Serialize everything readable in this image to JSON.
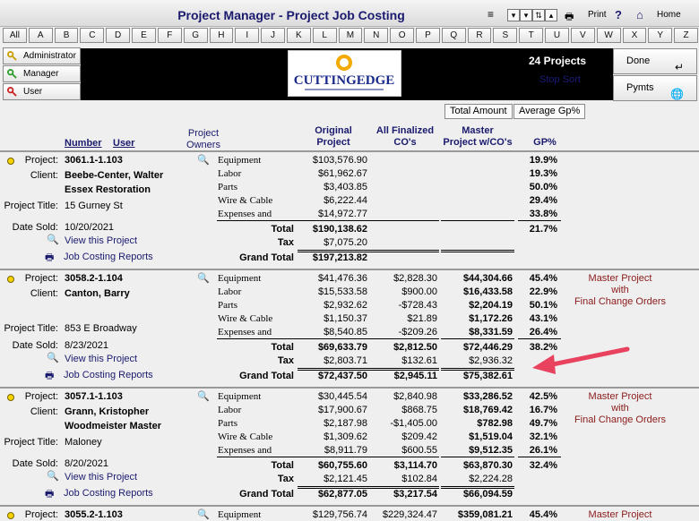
{
  "header": {
    "title": "Project Manager - Project Job Costing",
    "print_label": "Print",
    "help_label": "?",
    "home_label": "Home"
  },
  "alphabet": [
    "All",
    "A",
    "B",
    "C",
    "D",
    "E",
    "F",
    "G",
    "H",
    "I",
    "J",
    "K",
    "L",
    "M",
    "N",
    "O",
    "P",
    "Q",
    "R",
    "S",
    "T",
    "U",
    "V",
    "W",
    "X",
    "Y",
    "Z"
  ],
  "roles": [
    "Administrator",
    "Manager",
    "User"
  ],
  "logo_text": "CUTTINGEDGE",
  "project_count": "24 Projects",
  "stop_sort": "Stop Sort",
  "right_buttons": {
    "done": "Done",
    "pymts": "Pymts"
  },
  "toggles": {
    "total_amount": "Total Amount",
    "average_gp": "Average Gp%"
  },
  "columns": {
    "number": "Number",
    "user": "User",
    "project_owners_1": "Project",
    "project_owners_2": "Owners",
    "original_1": "Original",
    "original_2": "Project",
    "finalized_1": "All Finalized",
    "finalized_2": "CO's",
    "master_1": "Master",
    "master_2": "Project w/CO's",
    "gp": "GP%"
  },
  "labels": {
    "project": "Project:",
    "client": "Client:",
    "project_title": "Project Title:",
    "date_sold": "Date Sold:",
    "view_project": "View this Project",
    "job_costing": "Job Costing Reports",
    "total": "Total",
    "tax": "Tax",
    "grand_total": "Grand Total",
    "master_1": "Master Project",
    "master_2": "with",
    "master_3": "Final Change Orders"
  },
  "categories": [
    "Equipment",
    "Labor",
    "Parts",
    "Wire & Cable",
    "Expenses and"
  ],
  "projects": [
    {
      "number": "3061.1-1.103",
      "client_1": "Beebe-Center, Walter",
      "client_2": "Essex Restoration",
      "title": "15 Gurney St",
      "date_sold": "10/20/2021",
      "original": [
        "$103,576.90",
        "$61,962.67",
        "$3,403.85",
        "$6,222.44",
        "$14,972.77"
      ],
      "cos": [
        "",
        "",
        "",
        "",
        ""
      ],
      "master": [
        "",
        "",
        "",
        "",
        ""
      ],
      "gp": [
        "19.9%",
        "19.3%",
        "50.0%",
        "29.4%",
        "33.8%"
      ],
      "total": [
        "$190,138.62",
        "",
        "",
        "21.7%"
      ],
      "tax": [
        "$7,075.20",
        "",
        ""
      ],
      "grand": [
        "$197,213.82",
        "",
        ""
      ]
    },
    {
      "number": "3058.2-1.104",
      "client_1": "Canton, Barry",
      "client_2": "",
      "title": "853 E Broadway",
      "date_sold": "8/23/2021",
      "original": [
        "$41,476.36",
        "$15,533.58",
        "$2,932.62",
        "$1,150.37",
        "$8,540.85"
      ],
      "cos": [
        "$2,828.30",
        "$900.00",
        "-$728.43",
        "$21.89",
        "-$209.26"
      ],
      "master": [
        "$44,304.66",
        "$16,433.58",
        "$2,204.19",
        "$1,172.26",
        "$8,331.59"
      ],
      "gp": [
        "45.4%",
        "22.9%",
        "50.1%",
        "43.1%",
        "26.4%"
      ],
      "total": [
        "$69,633.79",
        "$2,812.50",
        "$72,446.29",
        "38.2%"
      ],
      "tax": [
        "$2,803.71",
        "$132.61",
        "$2,936.32"
      ],
      "grand": [
        "$72,437.50",
        "$2,945.11",
        "$75,382.61"
      ]
    },
    {
      "number": "3057.1-1.103",
      "client_1": "Grann, Kristopher",
      "client_2": "Woodmeister Master",
      "title": "Maloney",
      "date_sold": "8/20/2021",
      "original": [
        "$30,445.54",
        "$17,900.67",
        "$2,187.98",
        "$1,309.62",
        "$8,911.79"
      ],
      "cos": [
        "$2,840.98",
        "$868.75",
        "-$1,405.00",
        "$209.42",
        "$600.55"
      ],
      "master": [
        "$33,286.52",
        "$18,769.42",
        "$782.98",
        "$1,519.04",
        "$9,512.35"
      ],
      "gp": [
        "42.5%",
        "16.7%",
        "49.7%",
        "32.1%",
        "26.1%"
      ],
      "total": [
        "$60,755.60",
        "$3,114.70",
        "$63,870.30",
        "32.4%"
      ],
      "tax": [
        "$2,121.45",
        "$102.84",
        "$2,224.28"
      ],
      "grand": [
        "$62,877.05",
        "$3,217.54",
        "$66,094.59"
      ]
    },
    {
      "number": "3055.2-1.103",
      "first_row": {
        "cat": "Equipment",
        "original": "$129,756.74",
        "cos": "$229,324.47",
        "master": "$359,081.21",
        "gp": "45.4%"
      }
    }
  ],
  "colors": {
    "title": "#1a1a6e",
    "master_text": "#8b1a1a",
    "arrow": "#e8425f",
    "status_dot": "#f5d300"
  }
}
